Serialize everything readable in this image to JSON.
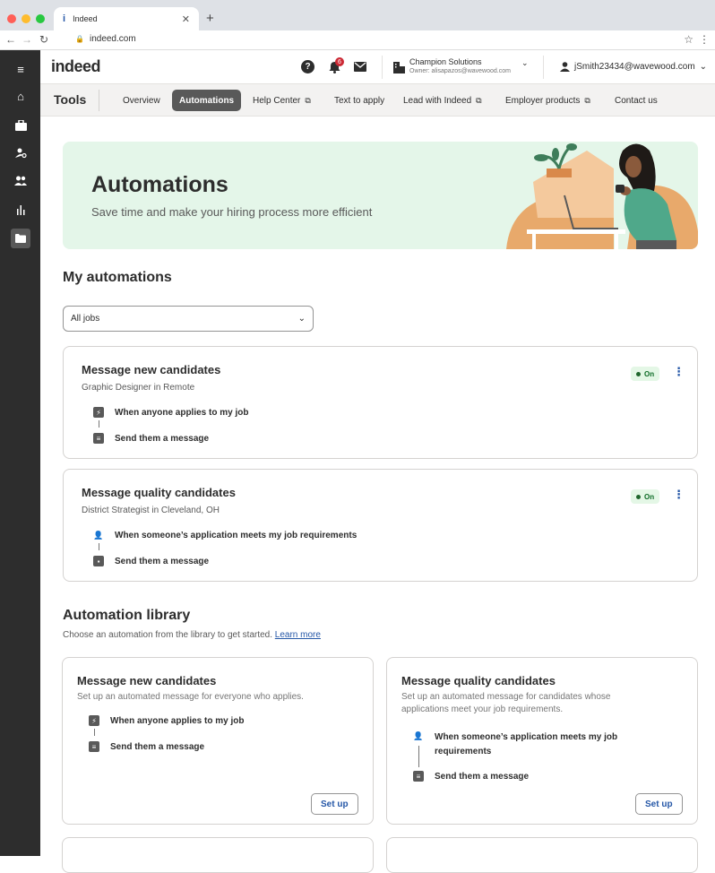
{
  "browser": {
    "tab_title": "Indeed",
    "url": "indeed.com"
  },
  "header": {
    "logo": "indeed",
    "notification_count": "6",
    "company_name": "Champion Solutions",
    "company_owner": "Owner: alisapazos@wavewood.com",
    "user_email": "jSmith23434@wavewood.com"
  },
  "tools": {
    "title": "Tools",
    "tabs": [
      "Overview",
      "Automations",
      "Help Center",
      "Text to apply",
      "Lead with Indeed",
      "Employer products",
      "Contact us"
    ]
  },
  "hero": {
    "title": "Automations",
    "subtitle": "Save time and make your hiring process more efficient"
  },
  "my_automations": {
    "title": "My automations",
    "filter_value": "All jobs",
    "cards": [
      {
        "title": "Message new candidates",
        "subtitle": "Graphic Designer in Remote",
        "status": "On",
        "trigger": "When anyone applies to my job",
        "action": "Send them a message"
      },
      {
        "title": "Message quality candidates",
        "subtitle": "District Strategist in Cleveland, OH",
        "status": "On",
        "trigger": "When someone’s application meets my job requirements",
        "action": "Send them a message"
      }
    ]
  },
  "library": {
    "title": "Automation library",
    "subtitle": "Choose an automation from the library to get started.",
    "learn_more": "Learn more",
    "cards": [
      {
        "title": "Message new candidates",
        "desc": "Set up an automated message for everyone who applies.",
        "trigger": "When anyone applies to my job",
        "action": "Send them a message",
        "button": "Set up"
      },
      {
        "title": "Message quality candidates",
        "desc": "Set up an automated message for candidates whose applications meet your job requirements.",
        "trigger": "When someone’s application meets my job requirements",
        "action": "Send them a message",
        "button": "Set up"
      }
    ]
  }
}
